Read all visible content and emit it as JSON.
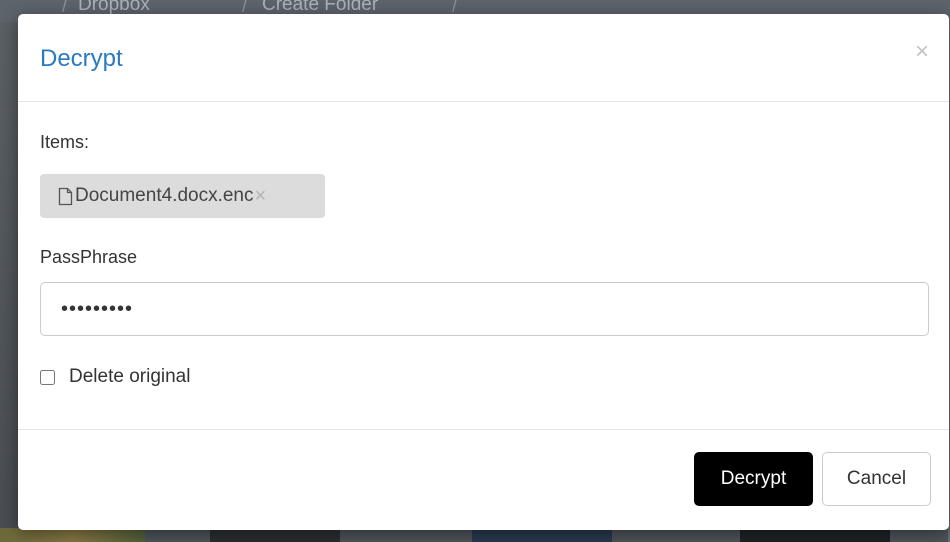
{
  "background": {
    "breadcrumbs": [
      "Dropbox",
      "Create Folder"
    ]
  },
  "dialog": {
    "title": "Decrypt",
    "close_glyph": "×",
    "close_icon": "close-icon",
    "items_label": "Items:",
    "items": [
      {
        "name": "Document4.docx.enc",
        "icon": "file-icon",
        "remove_glyph": "×"
      }
    ],
    "passphrase_label": "PassPhrase",
    "passphrase_value": "•••••••••",
    "delete_original_label": "Delete original",
    "delete_original_checked": false,
    "buttons": {
      "primary": "Decrypt",
      "secondary": "Cancel"
    }
  },
  "colors": {
    "title": "#2a7ac0",
    "primary_button": "#000000",
    "tag_background": "#dcdcdc"
  }
}
